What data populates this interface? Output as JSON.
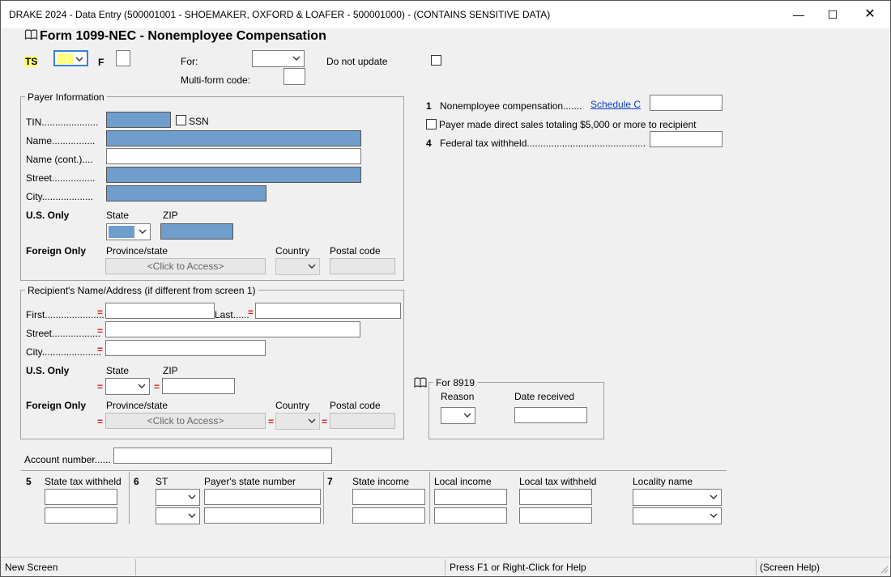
{
  "window": {
    "title": "DRAKE 2024 - Data Entry (500001001 - SHOEMAKER, OXFORD & LOAFER - 500001000) - (CONTAINS SENSITIVE DATA)"
  },
  "form": {
    "title": "Form 1099-NEC - Nonemployee Compensation",
    "ts_label": "TS",
    "f_label": "F",
    "for_label": "For:",
    "do_not_update_label": "Do not update",
    "multi_form_code_label": "Multi-form code:"
  },
  "payer": {
    "group_title": "Payer Information",
    "tin_label": "TIN.....................",
    "ssn_label": "SSN",
    "name_label": "Name................",
    "name_cont_label": "Name (cont.)....",
    "street_label": "Street................",
    "city_label": "City...................",
    "us_only_label": "U.S. Only",
    "state_label": "State",
    "zip_label": "ZIP",
    "foreign_only_label": "Foreign Only",
    "province_label": "Province/state",
    "country_label": "Country",
    "postal_label": "Postal code",
    "click_to_access": "<Click to Access>"
  },
  "recipient": {
    "group_title": "Recipient's Name/Address (if different from screen 1)",
    "first_label": "First......................",
    "last_label": "Last......",
    "street_label": "Street..................",
    "city_label": "City......................",
    "us_only_label": "U.S. Only",
    "state_label": "State",
    "zip_label": "ZIP",
    "foreign_only_label": "Foreign Only",
    "province_label": "Province/state",
    "country_label": "Country",
    "postal_label": "Postal code",
    "click_to_access": "<Click to Access>",
    "required_mark": "="
  },
  "boxes": {
    "box1_num": "1",
    "box1_label": "Nonemployee compensation.......",
    "schedule_c_link": "Schedule C",
    "direct_sales_label": "Payer made direct sales totaling $5,000 or more to recipient",
    "box4_num": "4",
    "box4_label": "Federal tax withheld............................................"
  },
  "f8919": {
    "group_title": "For 8919",
    "reason_label": "Reason",
    "date_received_label": "Date received"
  },
  "account": {
    "label": "Account number......"
  },
  "state_table": {
    "box5_num": "5",
    "box5_label": "State tax withheld",
    "box6_num": "6",
    "st_label": "ST",
    "payer_state_num_label": "Payer's state number",
    "box7_num": "7",
    "state_income_label": "State income",
    "local_income_label": "Local income",
    "local_tax_label": "Local tax withheld",
    "locality_label": "Locality name"
  },
  "statusbar": {
    "left": "New Screen",
    "middle": "Press F1 or Right-Click for Help",
    "right": "(Screen Help)"
  },
  "colors": {
    "filled_field": "#6f9dcc",
    "ts_highlight": "#ffff80",
    "required": "#d42020",
    "link": "#0b3fd1"
  },
  "icons": [
    "book-icon",
    "dropdown-arrow-icon",
    "minimize-icon",
    "maximize-icon",
    "close-icon",
    "resize-grip-icon"
  ]
}
